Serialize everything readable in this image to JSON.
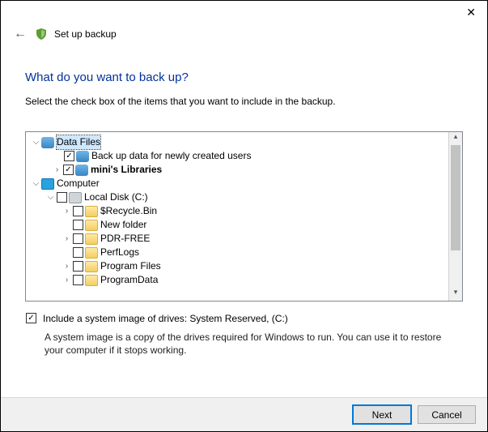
{
  "window": {
    "title": "Set up backup"
  },
  "heading": "What do you want to back up?",
  "instruction": "Select the check box of the items that you want to include in the backup.",
  "tree": {
    "data_files": {
      "label": "Data Files",
      "back_up_new_users": "Back up data for newly created users",
      "mini_libraries": "mini's Libraries"
    },
    "computer_label": "Computer",
    "local_disk": {
      "label": "Local Disk (C:)",
      "items": [
        "$Recycle.Bin",
        "New folder",
        "PDR-FREE",
        "PerfLogs",
        "Program Files",
        "ProgramData"
      ]
    }
  },
  "system_image": {
    "label": "Include a system image of drives: System Reserved, (C:)",
    "desc": "A system image is a copy of the drives required for Windows to run. You can use it to restore your computer if it stops working."
  },
  "buttons": {
    "next": "Next",
    "cancel": "Cancel"
  }
}
